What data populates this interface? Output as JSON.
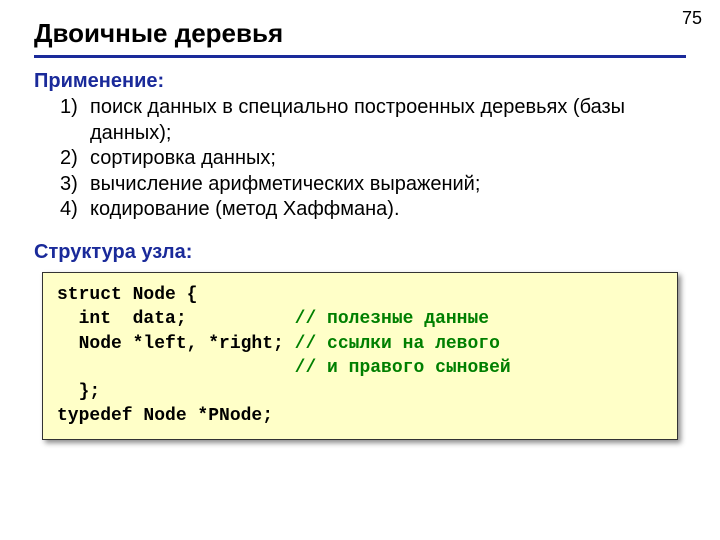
{
  "page_number": "75",
  "title": "Двоичные деревья",
  "section_application": "Применение:",
  "app_items": [
    "поиск данных в специально построенных деревьях (базы данных);",
    "сортировка данных;",
    "вычисление арифметических выражений;",
    "кодирование (метод Хаффмана)."
  ],
  "section_struct": "Структура узла:",
  "code": {
    "l1": "struct Node {",
    "l2a": "  int  data;          ",
    "l2b": "// полезные данные",
    "l3a": "  Node *left, *right; ",
    "l3b": "// ссылки на левого",
    "l4a": "                      ",
    "l4b": "// и правого сыновей",
    "l5": "  };",
    "l6": "typedef Node *PNode;"
  }
}
